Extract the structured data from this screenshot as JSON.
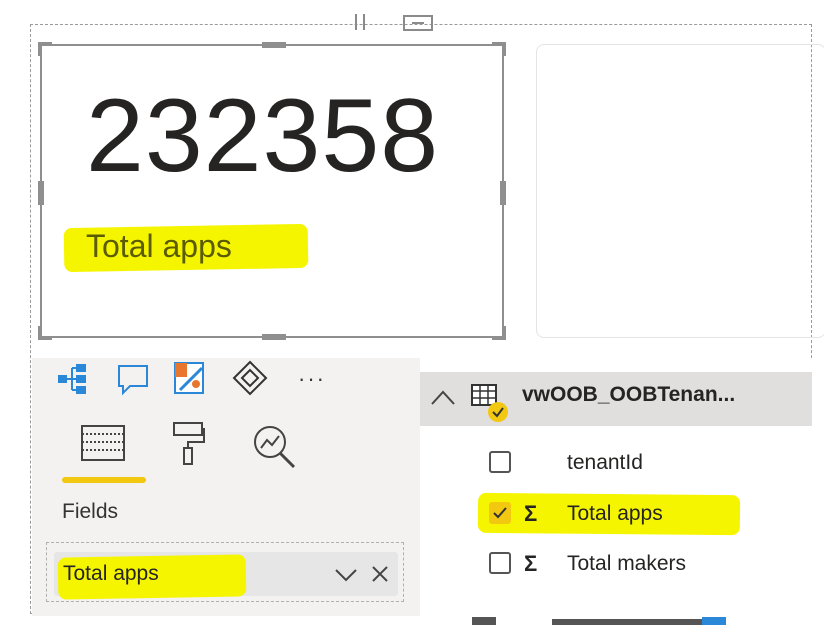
{
  "card": {
    "value": "232358",
    "label": "Total apps"
  },
  "visualizations": {
    "more_label": "···",
    "tabs": [
      {
        "name": "fields-tab",
        "icon": "table-grid-icon",
        "active": true
      },
      {
        "name": "format-tab",
        "icon": "paint-roller-icon",
        "active": false
      },
      {
        "name": "analytics-tab",
        "icon": "magnifier-chart-icon",
        "active": false
      }
    ],
    "fields_label": "Fields",
    "field_well": {
      "value": "Total apps"
    }
  },
  "fields_pane": {
    "table_name": "vwOOB_OOBTenan...",
    "fields": [
      {
        "name": "tenantId",
        "checked": false,
        "sigma": false
      },
      {
        "name": "Total apps",
        "checked": true,
        "sigma": true
      },
      {
        "name": "Total makers",
        "checked": false,
        "sigma": true
      }
    ]
  },
  "colors": {
    "highlight": "#f5f500",
    "accent": "#f2c811",
    "pane_bg": "#f3f2f1"
  }
}
